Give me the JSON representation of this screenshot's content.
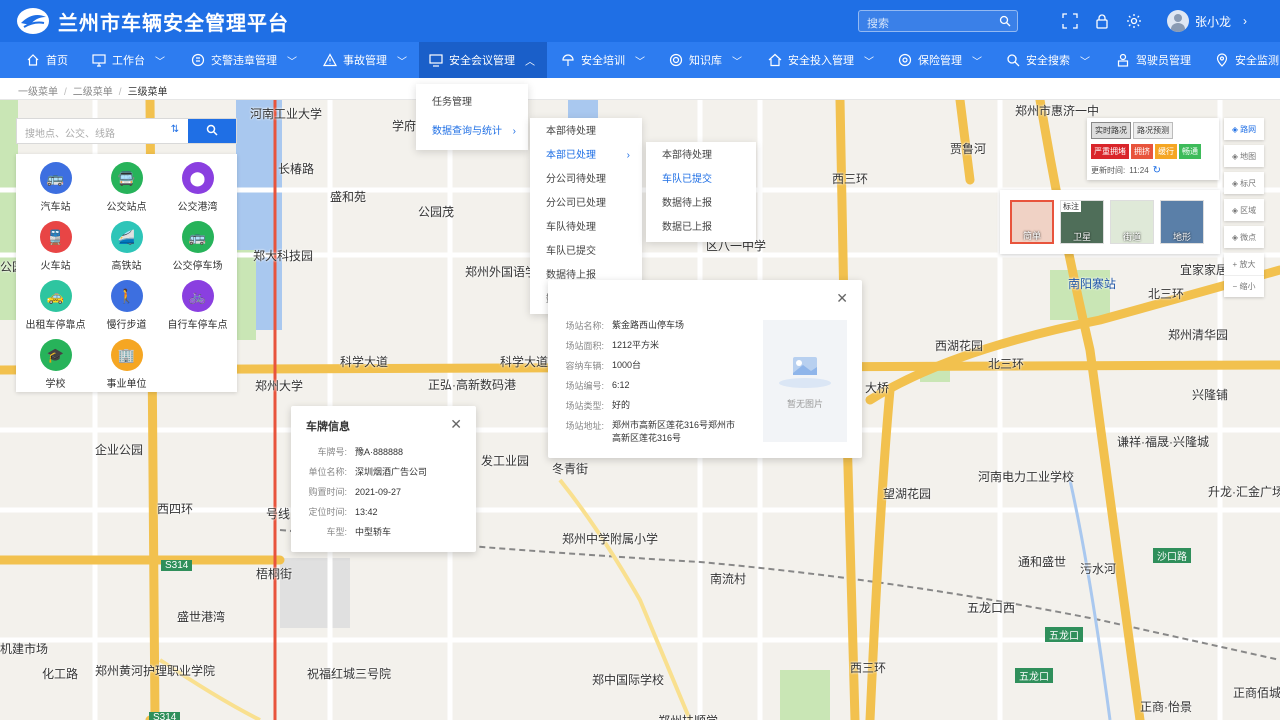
{
  "header": {
    "title": "兰州市车辆安全管理平台",
    "search_placeholder": "搜索",
    "user_name": "张小龙"
  },
  "nav": [
    {
      "label": "首页",
      "icon": "home-icon",
      "chevron": false
    },
    {
      "label": "工作台",
      "icon": "monitor-icon",
      "chevron": true
    },
    {
      "label": "交警违章管理",
      "icon": "ticket-icon",
      "chevron": true
    },
    {
      "label": "事故管理",
      "icon": "warning-icon",
      "chevron": true
    },
    {
      "label": "安全会议管理",
      "icon": "screen-icon",
      "chevron": true,
      "active": true
    },
    {
      "label": "安全培训",
      "icon": "lamp-icon",
      "chevron": true
    },
    {
      "label": "知识库",
      "icon": "target-icon",
      "chevron": true
    },
    {
      "label": "安全投入管理",
      "icon": "house-icon",
      "chevron": true
    },
    {
      "label": "保险管理",
      "icon": "shield-ring-icon",
      "chevron": true
    },
    {
      "label": "安全搜索",
      "icon": "search-icon",
      "chevron": true
    },
    {
      "label": "驾驶员管理",
      "icon": "driver-icon",
      "chevron": false
    },
    {
      "label": "安全监测",
      "icon": "location-icon",
      "chevron": true
    }
  ],
  "breadcrumb": {
    "level1": "一级菜单",
    "level2": "二级菜单",
    "level3": "三级菜单",
    "sep": "/"
  },
  "menu1": [
    {
      "label": "任务管理"
    },
    {
      "label": "数据查询与统计",
      "selected": true,
      "arrow": "›"
    }
  ],
  "menu2": [
    {
      "label": "本部待处理"
    },
    {
      "label": "本部已处理",
      "selected": true,
      "arrow": "›"
    },
    {
      "label": "分公司待处理"
    },
    {
      "label": "分公司已处理"
    },
    {
      "label": "车队待处理"
    },
    {
      "label": "车队已提交"
    },
    {
      "label": "数据待上报"
    },
    {
      "label": "数据已上报"
    }
  ],
  "menu3": [
    {
      "label": "本部待处理"
    },
    {
      "label": "车队已提交",
      "selected": true
    },
    {
      "label": "数据待上报"
    },
    {
      "label": "数据已上报"
    }
  ],
  "left_search": {
    "placeholder": "搜地点、公交、线路",
    "swap": "⇅"
  },
  "categories": [
    {
      "label": "汽车站",
      "color": "#3d6fe0",
      "glyph": "🚌"
    },
    {
      "label": "公交站点",
      "color": "#27b35a",
      "glyph": "🚍"
    },
    {
      "label": "公交港湾",
      "color": "#8a3fe0",
      "glyph": "⬤"
    },
    {
      "label": "火车站",
      "color": "#e84545",
      "glyph": "🚆"
    },
    {
      "label": "高铁站",
      "color": "#2ec5b8",
      "glyph": "🚄"
    },
    {
      "label": "公交停车场",
      "color": "#27b35a",
      "glyph": "🚌"
    },
    {
      "label": "出租车停靠点",
      "color": "#2ec5a0",
      "glyph": "🚕"
    },
    {
      "label": "慢行步道",
      "color": "#3d6fe0",
      "glyph": "🚶"
    },
    {
      "label": "自行车停车点",
      "color": "#8a3fe0",
      "glyph": "🚲"
    },
    {
      "label": "学校",
      "color": "#27b35a",
      "glyph": "🎓"
    },
    {
      "label": "事业单位",
      "color": "#f5a623",
      "glyph": "🏢"
    }
  ],
  "vehicle_card": {
    "title": "车牌信息",
    "rows": [
      {
        "k": "车牌号:",
        "v": "豫A·888888"
      },
      {
        "k": "单位名称:",
        "v": "深圳烟酒广告公司"
      },
      {
        "k": "购置时间:",
        "v": "2021-09-27"
      },
      {
        "k": "定位时间:",
        "v": "13:42"
      },
      {
        "k": "车型:",
        "v": "中型轿车"
      }
    ]
  },
  "station_card": {
    "rows": [
      {
        "k": "场站名称:",
        "v": "紫金路西山停车场"
      },
      {
        "k": "场站面积:",
        "v": "1212平方米"
      },
      {
        "k": "容纳车辆:",
        "v": "1000台"
      },
      {
        "k": "场站编号:",
        "v": "6:12"
      },
      {
        "k": "场站类型:",
        "v": "好的"
      },
      {
        "k": "场站地址:",
        "v": "郑州市高新区莲花316号郑州市高新区莲花316号"
      }
    ],
    "no_image": "暂无图片"
  },
  "traffic": {
    "realtime": "实时路况",
    "forecast": "路况预测",
    "legend": [
      "严重拥堵",
      "拥挤",
      "缓行",
      "畅通"
    ],
    "legend_colors": [
      "#d9252a",
      "#e8543c",
      "#f5a623",
      "#3dbb5a"
    ],
    "update_label": "更新时间:",
    "update_time": "11:24"
  },
  "map_types": [
    {
      "label": "简单",
      "selected": true
    },
    {
      "label": "卫星",
      "badge": "标注"
    },
    {
      "label": "街道"
    },
    {
      "label": "地形"
    }
  ],
  "tools": [
    {
      "label": "路网",
      "on": true
    },
    {
      "label": "地图"
    },
    {
      "label": "标尺"
    },
    {
      "label": "区域"
    },
    {
      "label": "微点"
    }
  ],
  "zoom": {
    "in": "放大",
    "out": "缩小"
  },
  "map_labels": [
    "河南工业大学",
    "学府",
    "盛和苑",
    "公园茂",
    "郑大科技园",
    "郑州外国语学",
    "科学大道",
    "科学大道",
    "郑州大学",
    "正弘·高新数码港",
    "企业公园",
    "郑州中学附属小学",
    "南流村",
    "冬青街",
    "梧桐街",
    "盛世港湾",
    "郑州黄河护理职业学院",
    "祝福红城三号院",
    "郑中国际学校",
    "郑州市惠济一中",
    "南阳寨站",
    "北三环",
    "北三环",
    "西湖花园",
    "宜家家居",
    "郑州清华园",
    "兴隆铺",
    "大桥",
    "望湖花园",
    "河南电力工业学校",
    "谦祥·福晟·兴隆城",
    "升龙·汇金广场",
    "通和盛世",
    "沙口路",
    "五龙口西",
    "五龙口",
    "五龙口",
    "正商佰城",
    "发工业园",
    "西四环",
    "S314",
    "S314",
    "西三环",
    "机建市场",
    "化工路",
    "郑州扶顺学",
    "区八一中学",
    "西三环",
    "贾鲁河",
    "污水河",
    "正商·怡景",
    "长椿路",
    "公园",
    "号线",
    "五龙口西"
  ]
}
